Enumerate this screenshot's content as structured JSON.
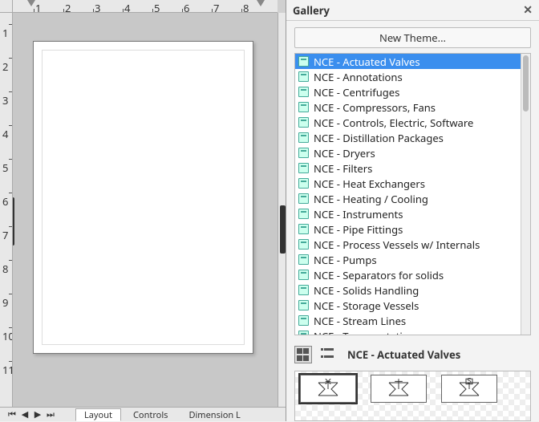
{
  "gallery": {
    "title": "Gallery",
    "new_theme_label": "New Theme...",
    "themes": [
      "NCE - Actuated Valves",
      "NCE - Annotations",
      "NCE - Centrifuges",
      "NCE - Compressors, Fans",
      "NCE - Controls, Electric, Software",
      "NCE - Distillation Packages",
      "NCE - Dryers",
      "NCE - Filters",
      "NCE - Heat Exchangers",
      "NCE - Heating / Cooling",
      "NCE - Instruments",
      "NCE - Pipe Fittings",
      "NCE - Process Vessels w/ Internals",
      "NCE - Pumps",
      "NCE - Separators for solids",
      "NCE - Solids Handling",
      "NCE - Storage Vessels",
      "NCE - Stream Lines",
      "NCE - Transportation"
    ],
    "selected_index": 0,
    "current_theme_label": "NCE - Actuated Valves"
  },
  "tabs": {
    "items": [
      "Layout",
      "Controls",
      "Dimension L"
    ],
    "active_index": 0
  },
  "ruler": {
    "h_ticks": [
      "1",
      "2",
      "3",
      "4",
      "5",
      "6",
      "7",
      "8"
    ],
    "v_ticks": [
      "1",
      "2",
      "3",
      "4",
      "5",
      "6",
      "7",
      "8",
      "9",
      "10",
      "11"
    ]
  }
}
